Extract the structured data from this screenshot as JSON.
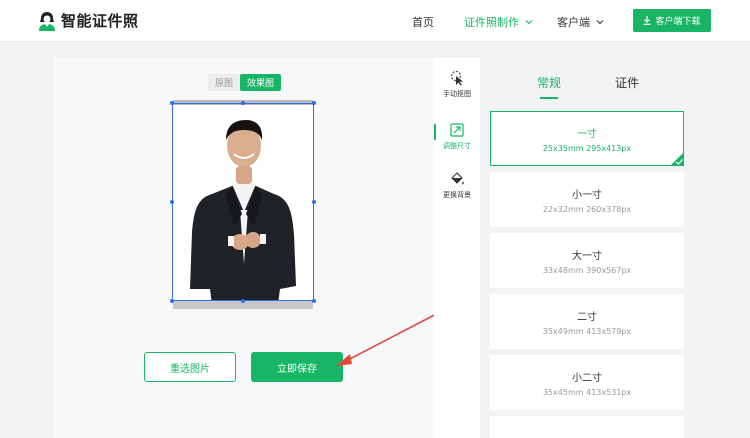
{
  "header": {
    "logo_text": "智能证件照",
    "nav": {
      "home": "首页",
      "make": "证件照制作",
      "client": "客户端"
    },
    "download_label": "客户端下载"
  },
  "editor": {
    "toggle": {
      "original": "原图",
      "effect": "效果图"
    },
    "reselect_label": "重选图片",
    "save_label": "立即保存"
  },
  "tools": [
    {
      "label": "手动抠图",
      "icon": "cursor-icon"
    },
    {
      "label": "调整尺寸",
      "icon": "resize-icon"
    },
    {
      "label": "更换背景",
      "icon": "paint-bucket-icon"
    }
  ],
  "panel": {
    "tabs": [
      "常规",
      "证件"
    ],
    "sizes": [
      {
        "name": "一寸",
        "spec": "25x35mm 295x413px",
        "selected": true
      },
      {
        "name": "小一寸",
        "spec": "22x32mm 260x378px"
      },
      {
        "name": "大一寸",
        "spec": "33x48mm 390x567px"
      },
      {
        "name": "二寸",
        "spec": "35x49mm 413x579px"
      },
      {
        "name": "小二寸",
        "spec": "35x45mm 413x531px"
      }
    ]
  },
  "colors": {
    "accent": "#18b566",
    "selection": "#2f6fe0",
    "annotation_arrow": "#e04a3a"
  }
}
